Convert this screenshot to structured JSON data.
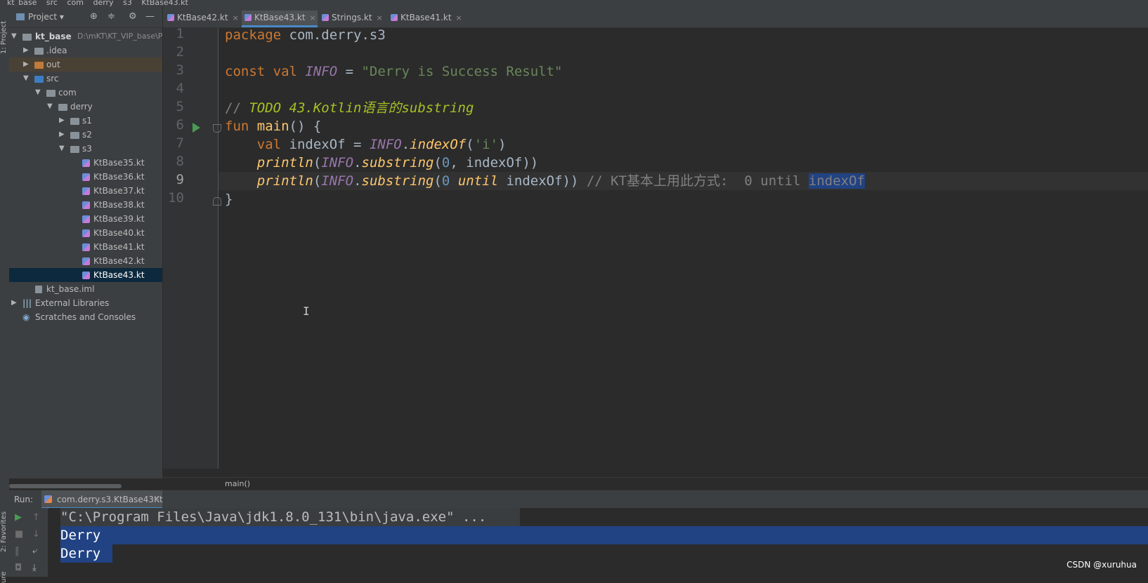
{
  "breadcrumbs": [
    "kt_base",
    "src",
    "com",
    "derry",
    "s3",
    "KtBase43.kt"
  ],
  "left_stripe": {
    "project_label": "1: Project",
    "favorites_label": "2: Favorites",
    "structure_label": "ure"
  },
  "project_panel": {
    "title": "Project"
  },
  "tabs": [
    {
      "label": "KtBase42.kt",
      "active": false
    },
    {
      "label": "KtBase43.kt",
      "active": true
    },
    {
      "label": "Strings.kt",
      "active": false
    },
    {
      "label": "KtBase41.kt",
      "active": false
    }
  ],
  "tree": {
    "root": {
      "name": "kt_base",
      "path": "D:\\mKT\\KT_VIP_base\\Pr"
    },
    "idea": ".idea",
    "out": "out",
    "src": "src",
    "com": "com",
    "derry": "derry",
    "s1": "s1",
    "s2": "s2",
    "s3": "s3",
    "files": [
      "KtBase35.kt",
      "KtBase36.kt",
      "KtBase37.kt",
      "KtBase38.kt",
      "KtBase39.kt",
      "KtBase40.kt",
      "KtBase41.kt",
      "KtBase42.kt",
      "KtBase43.kt"
    ],
    "selected_file": "KtBase43.kt",
    "iml": "kt_base.iml",
    "external_libraries": "External Libraries",
    "scratches": "Scratches and Consoles"
  },
  "editor": {
    "line_numbers": [
      "1",
      "2",
      "3",
      "4",
      "5",
      "6",
      "7",
      "8",
      "9",
      "10"
    ],
    "line1": {
      "kw": "package",
      "rest": " com.derry.s3"
    },
    "line3": {
      "kw1": "const val ",
      "name": "INFO",
      "eq": " = ",
      "str": "\"Derry is Success Result\""
    },
    "line5": {
      "slashes": "// ",
      "todo": "TODO 43.Kotlin语言的substring"
    },
    "line6": {
      "kw": "fun ",
      "fn": "main",
      "rest": "() {"
    },
    "line7": {
      "indent": "    ",
      "kw": "val ",
      "var": "indexOf",
      "eq": " = ",
      "const": "INFO",
      "dot": ".",
      "fn": "indexOf",
      "open": "(",
      "str": "'i'",
      "close": ")"
    },
    "line8": {
      "indent": "    ",
      "fn": "println",
      "p1": "(",
      "const": "INFO",
      "dot": ".",
      "fn2": "substring",
      "p2": "(",
      "num": "0",
      "comma": ", ",
      "rest": "indexOf))"
    },
    "line9": {
      "indent": "    ",
      "fn": "println",
      "p1": "(",
      "const": "INFO",
      "dot": ".",
      "fn2": "substring",
      "p2": "(",
      "num": "0",
      "kw": " until",
      "rest": " indexOf)) ",
      "comment": "// KT基本上用此方式:  0 until ",
      "highlight": "indexOf"
    },
    "line10": {
      "text": "}"
    }
  },
  "nav_breadcrumb": "main()",
  "run_panel": {
    "label": "Run:",
    "config": "com.derry.s3.KtBase43Kt",
    "output": [
      "\"C:\\Program Files\\Java\\jdk1.8.0_131\\bin\\java.exe\" ...",
      "Derry",
      "Derry"
    ]
  },
  "watermark": "CSDN @xuruhua"
}
